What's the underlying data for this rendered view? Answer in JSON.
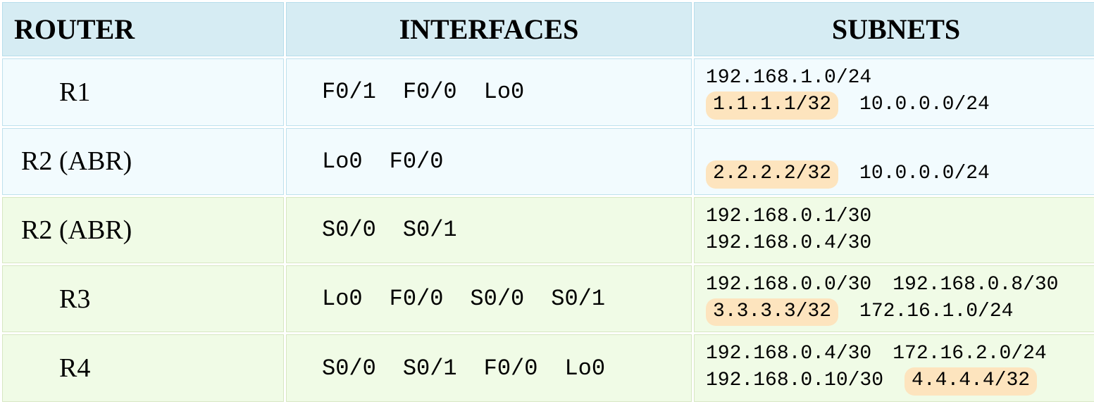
{
  "headers": {
    "router": "ROUTER",
    "interfaces": "INTERFACES",
    "subnets": "SUBNETS"
  },
  "rows": [
    {
      "router": "R1",
      "indent": true,
      "color": "blue",
      "interfaces": [
        "F0/1",
        "F0/0",
        "Lo0"
      ],
      "subnets": [
        [
          {
            "text": "192.168.1.0/24",
            "hl": false
          }
        ],
        [
          {
            "text": "1.1.1.1/32",
            "hl": true
          },
          {
            "text": "10.0.0.0/24",
            "hl": false
          }
        ]
      ]
    },
    {
      "router": "R2 (ABR)",
      "indent": false,
      "color": "blue",
      "interfaces": [
        "Lo0",
        "F0/0"
      ],
      "subnets": [
        [],
        [
          {
            "text": "2.2.2.2/32",
            "hl": true
          },
          {
            "text": "10.0.0.0/24",
            "hl": false
          }
        ]
      ]
    },
    {
      "router": "R2 (ABR)",
      "indent": false,
      "color": "green",
      "interfaces": [
        "S0/0",
        "S0/1"
      ],
      "subnets": [
        [
          {
            "text": "192.168.0.1/30",
            "hl": false
          }
        ],
        [
          {
            "text": "192.168.0.4/30",
            "hl": false
          }
        ]
      ]
    },
    {
      "router": "R3",
      "indent": true,
      "color": "green",
      "interfaces": [
        "Lo0",
        "F0/0",
        "S0/0",
        "S0/1"
      ],
      "subnets": [
        [
          {
            "text": "192.168.0.0/30",
            "hl": false
          },
          {
            "text": "192.168.0.8/30",
            "hl": false
          }
        ],
        [
          {
            "text": "3.3.3.3/32",
            "hl": true
          },
          {
            "text": "172.16.1.0/24",
            "hl": false
          }
        ]
      ]
    },
    {
      "router": "R4",
      "indent": true,
      "color": "green",
      "interfaces": [
        "S0/0",
        "S0/1",
        "F0/0",
        "Lo0"
      ],
      "subnets": [
        [
          {
            "text": "192.168.0.4/30",
            "hl": false
          },
          {
            "text": "172.16.2.0/24",
            "hl": false
          }
        ],
        [
          {
            "text": "192.168.0.10/30",
            "hl": false
          },
          {
            "text": "4.4.4.4/32",
            "hl": true
          }
        ]
      ]
    }
  ]
}
